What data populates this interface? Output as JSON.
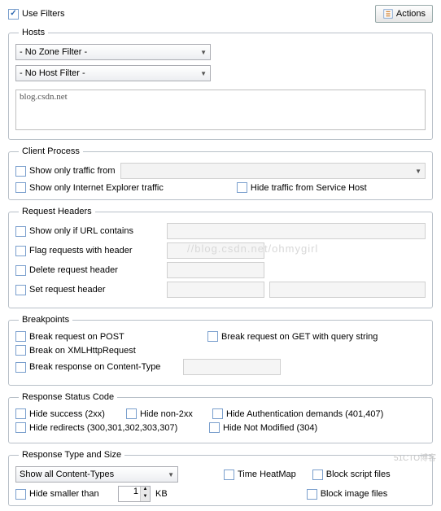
{
  "topbar": {
    "use_filters": "Use Filters",
    "actions": "Actions"
  },
  "hosts": {
    "legend": "Hosts",
    "zone_filter": "- No Zone Filter -",
    "host_filter": "- No Host Filter -",
    "textarea_value": "blog.csdn.net"
  },
  "client_process": {
    "legend": "Client Process",
    "show_only_from": "Show only traffic from",
    "show_only_ie": "Show only Internet Explorer traffic",
    "hide_service_host": "Hide traffic from Service Host"
  },
  "request_headers": {
    "legend": "Request Headers",
    "show_only_url": "Show only if URL contains",
    "flag_header": "Flag requests with header",
    "delete_header": "Delete request header",
    "set_header": "Set request header"
  },
  "breakpoints": {
    "legend": "Breakpoints",
    "break_post": "Break request on POST",
    "break_get_qs": "Break request on GET with query string",
    "break_xhr": "Break on XMLHttpRequest",
    "break_ct": "Break response on Content-Type"
  },
  "response_status": {
    "legend": "Response Status Code",
    "hide_2xx": "Hide success (2xx)",
    "hide_non2xx": "Hide non-2xx",
    "hide_auth": "Hide Authentication demands (401,407)",
    "hide_redirects": "Hide redirects (300,301,302,303,307)",
    "hide_notmod": "Hide Not Modified (304)"
  },
  "response_type": {
    "legend": "Response Type and Size",
    "show_all_ct": "Show all Content-Types",
    "time_heatmap": "Time HeatMap",
    "block_scripts": "Block script files",
    "hide_smaller": "Hide smaller than",
    "block_images": "Block image files",
    "size_value": "1",
    "size_unit": "KB"
  },
  "watermarks": {
    "side": "51CTO博客",
    "mid": "//blog.csdn.net/ohmygirl"
  }
}
